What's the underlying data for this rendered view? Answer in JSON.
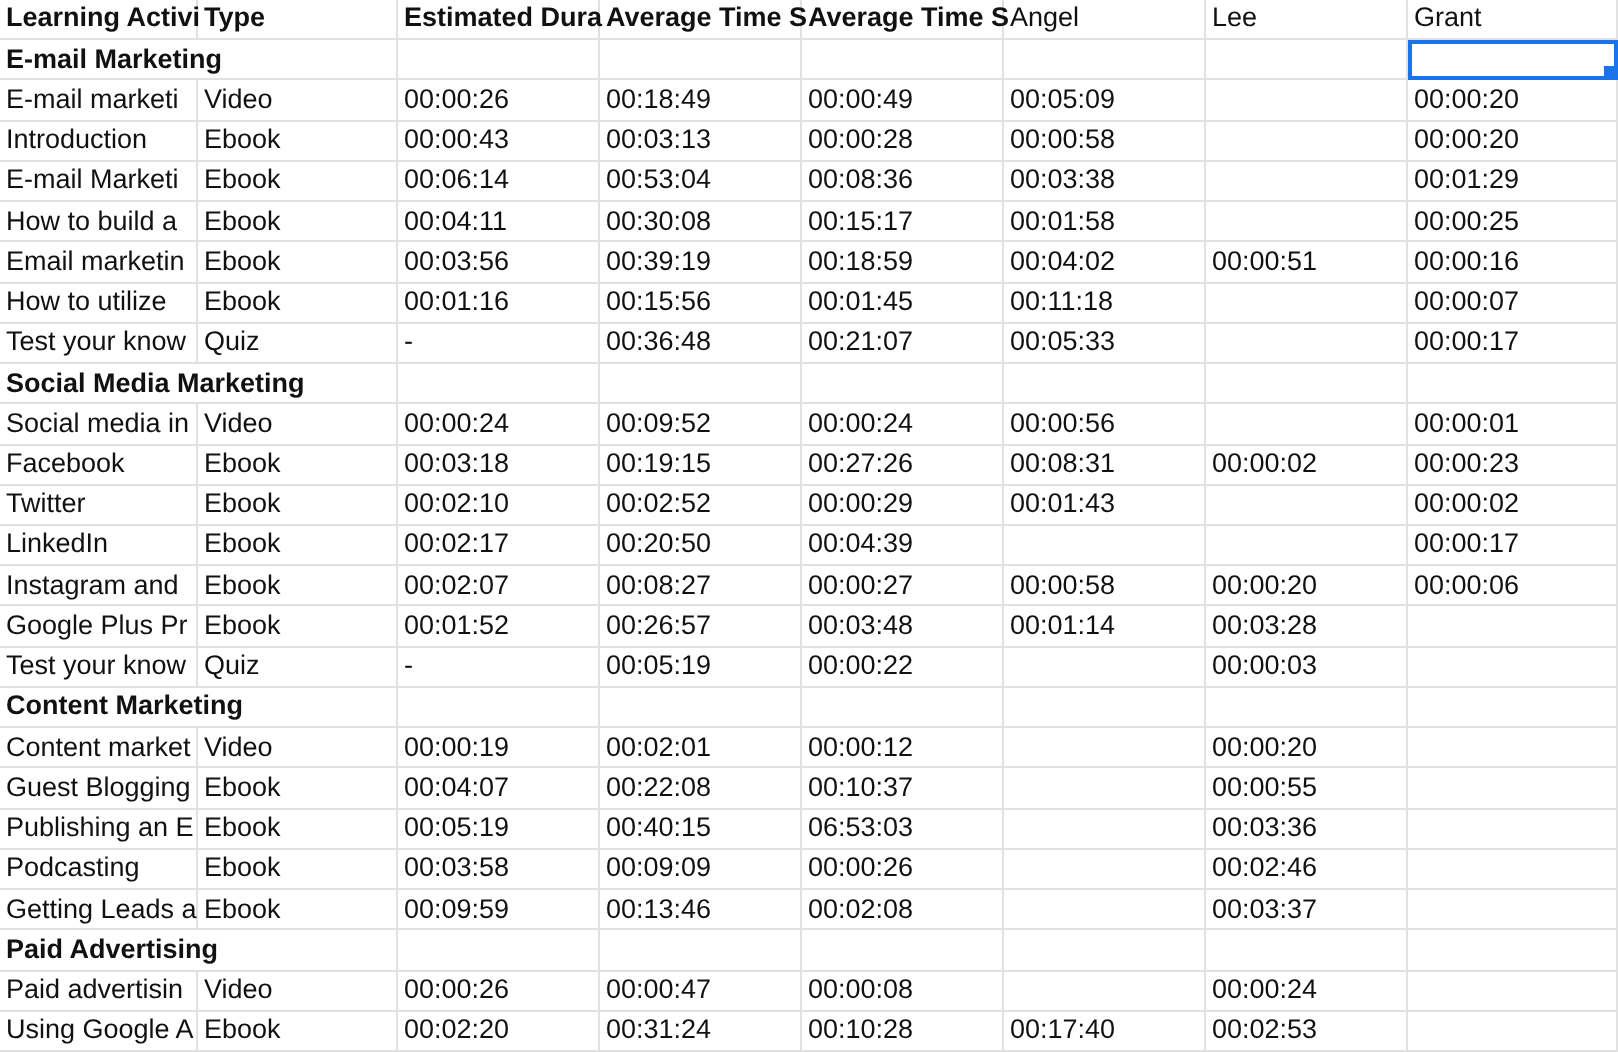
{
  "columns": [
    {
      "label": "Learning Activi",
      "bold": true
    },
    {
      "label": "Type",
      "bold": true
    },
    {
      "label": "Estimated Dura",
      "bold": true
    },
    {
      "label": "Average Time S",
      "bold": true
    },
    {
      "label": "Average Time S",
      "bold": true
    },
    {
      "label": "Angel",
      "bold": false
    },
    {
      "label": "Lee",
      "bold": false
    },
    {
      "label": "Grant",
      "bold": false
    }
  ],
  "rows": [
    {
      "kind": "section",
      "title": "E-mail Marketing",
      "grant_cell_selected": true
    },
    {
      "kind": "item",
      "cells": [
        "E-mail marketi",
        "Video",
        "00:00:26",
        "00:18:49",
        "00:00:49",
        "00:05:09",
        null,
        "00:00:20"
      ]
    },
    {
      "kind": "item",
      "cells": [
        "Introduction",
        "Ebook",
        "00:00:43",
        "00:03:13",
        "00:00:28",
        "00:00:58",
        null,
        "00:00:20"
      ]
    },
    {
      "kind": "item",
      "cells": [
        "E-mail Marketi",
        "Ebook",
        "00:06:14",
        "00:53:04",
        "00:08:36",
        "00:03:38",
        null,
        "00:01:29"
      ]
    },
    {
      "kind": "item",
      "cells": [
        "How to build a",
        "Ebook",
        "00:04:11",
        "00:30:08",
        "00:15:17",
        "00:01:58",
        null,
        "00:00:25"
      ]
    },
    {
      "kind": "item",
      "cells": [
        "Email marketin",
        "Ebook",
        "00:03:56",
        "00:39:19",
        "00:18:59",
        "00:04:02",
        "00:00:51",
        "00:00:16"
      ]
    },
    {
      "kind": "item",
      "cells": [
        "How to utilize",
        "Ebook",
        "00:01:16",
        "00:15:56",
        "00:01:45",
        "00:11:18",
        null,
        "00:00:07"
      ]
    },
    {
      "kind": "item",
      "cells": [
        "Test your know",
        "Quiz",
        "-",
        "00:36:48",
        "00:21:07",
        "00:05:33",
        null,
        "00:00:17"
      ]
    },
    {
      "kind": "section",
      "title": "Social Media Marketing",
      "grant_cell_selected": false
    },
    {
      "kind": "item",
      "cells": [
        "Social media in",
        "Video",
        "00:00:24",
        "00:09:52",
        "00:00:24",
        "00:00:56",
        null,
        "00:00:01"
      ]
    },
    {
      "kind": "item",
      "cells": [
        "Facebook",
        "Ebook",
        "00:03:18",
        "00:19:15",
        "00:27:26",
        "00:08:31",
        "00:00:02",
        "00:00:23"
      ]
    },
    {
      "kind": "item",
      "cells": [
        "Twitter",
        "Ebook",
        "00:02:10",
        "00:02:52",
        "00:00:29",
        "00:01:43",
        null,
        "00:00:02"
      ]
    },
    {
      "kind": "item",
      "cells": [
        "LinkedIn",
        "Ebook",
        "00:02:17",
        "00:20:50",
        "00:04:39",
        null,
        null,
        "00:00:17"
      ]
    },
    {
      "kind": "item",
      "cells": [
        "Instagram and",
        "Ebook",
        "00:02:07",
        "00:08:27",
        "00:00:27",
        "00:00:58",
        "00:00:20",
        "00:00:06"
      ]
    },
    {
      "kind": "item",
      "cells": [
        "Google Plus Pr",
        "Ebook",
        "00:01:52",
        "00:26:57",
        "00:03:48",
        "00:01:14",
        "00:03:28",
        null
      ]
    },
    {
      "kind": "item",
      "cells": [
        "Test your know",
        "Quiz",
        "-",
        "00:05:19",
        "00:00:22",
        null,
        "00:00:03",
        null
      ]
    },
    {
      "kind": "section",
      "title": "Content Marketing",
      "grant_cell_selected": false
    },
    {
      "kind": "item",
      "cells": [
        "Content market",
        "Video",
        "00:00:19",
        "00:02:01",
        "00:00:12",
        null,
        "00:00:20",
        null
      ]
    },
    {
      "kind": "item",
      "cells": [
        "Guest Blogging",
        "Ebook",
        "00:04:07",
        "00:22:08",
        "00:10:37",
        null,
        "00:00:55",
        null
      ]
    },
    {
      "kind": "item",
      "cells": [
        "Publishing an E",
        "Ebook",
        "00:05:19",
        "00:40:15",
        "06:53:03",
        null,
        "00:03:36",
        null
      ]
    },
    {
      "kind": "item",
      "cells": [
        "Podcasting",
        "Ebook",
        "00:03:58",
        "00:09:09",
        "00:00:26",
        null,
        "00:02:46",
        null
      ]
    },
    {
      "kind": "item",
      "cells": [
        "Getting Leads a",
        "Ebook",
        "00:09:59",
        "00:13:46",
        "00:02:08",
        null,
        "00:03:37",
        null
      ]
    },
    {
      "kind": "section",
      "title": "Paid Advertising",
      "grant_cell_selected": false
    },
    {
      "kind": "item",
      "cells": [
        "Paid advertisin",
        "Video",
        "00:00:26",
        "00:00:47",
        "00:00:08",
        null,
        "00:00:24",
        null
      ]
    },
    {
      "kind": "item",
      "cells": [
        "Using Google A",
        "Ebook",
        "00:02:20",
        "00:31:24",
        "00:10:28",
        "00:17:40",
        "00:02:53",
        null
      ]
    }
  ]
}
